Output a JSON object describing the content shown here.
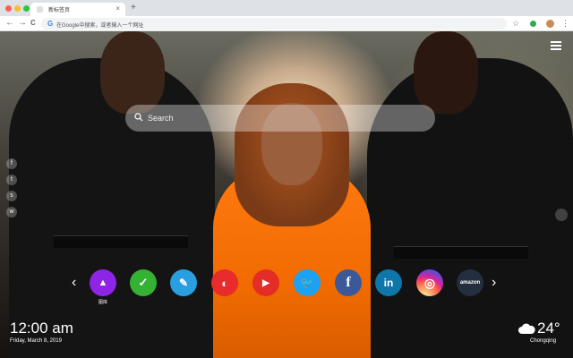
{
  "browser": {
    "tab_title": "新标签页",
    "tab_close": "×",
    "new_tab": "+",
    "back": "←",
    "forward": "→",
    "reload": "C",
    "omnibox_placeholder": "在Google中搜索，或者输入一个网址",
    "omnibox_g": "G",
    "bookmark": "☆",
    "menu": "⋮",
    "traffic_colors": [
      "#ff5f57",
      "#febc2e",
      "#28c840"
    ]
  },
  "search": {
    "placeholder": "Search"
  },
  "social_side": [
    {
      "icon": "facebook-icon",
      "glyph": "f"
    },
    {
      "icon": "twitter-icon",
      "glyph": "t"
    },
    {
      "icon": "snapchat-icon",
      "glyph": "s"
    },
    {
      "icon": "wechat-icon",
      "glyph": "w"
    }
  ],
  "dock": {
    "prev": "‹",
    "next": "›",
    "apps": [
      {
        "icon": "gallery-icon",
        "label": "图库",
        "color": "#8e24e5",
        "glyph": "▲"
      },
      {
        "icon": "checklist-icon",
        "label": "",
        "color": "#34b233",
        "glyph": "✓"
      },
      {
        "icon": "notes-icon",
        "label": "",
        "color": "#2a9fe0",
        "glyph": "✎"
      },
      {
        "icon": "palette-icon",
        "label": "",
        "color": "#e82b2b",
        "glyph": "◐"
      },
      {
        "icon": "youtube-icon",
        "label": "",
        "color": "#e52d27",
        "glyph": "▶"
      },
      {
        "icon": "twitter-icon",
        "label": "",
        "color": "#1da1f2",
        "glyph": "🐦"
      },
      {
        "icon": "facebook-icon",
        "label": "",
        "color": "#3b5998",
        "glyph": "f"
      },
      {
        "icon": "linkedin-icon",
        "label": "",
        "color": "#0e76a8",
        "glyph": "in"
      },
      {
        "icon": "instagram-icon",
        "label": "",
        "color": "#d6249f",
        "glyph": "◎"
      },
      {
        "icon": "amazon-icon",
        "label": "",
        "color": "#232f3e",
        "glyph": "amazon"
      }
    ]
  },
  "clock": {
    "time": "12:00 am",
    "date": "Friday, March 8, 2019"
  },
  "weather": {
    "temp": "24°",
    "city": "Chongqing"
  }
}
